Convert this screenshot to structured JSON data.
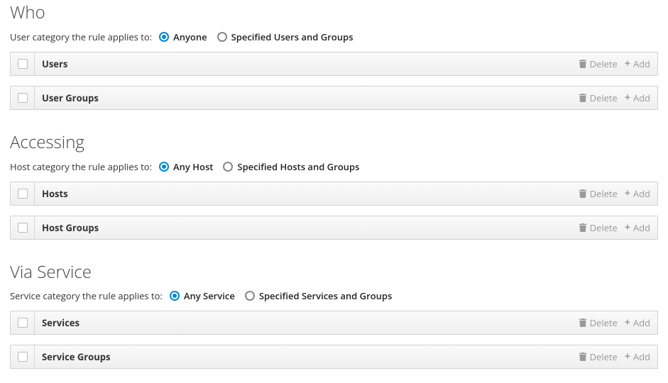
{
  "common": {
    "delete_label": "Delete",
    "add_label": "Add"
  },
  "sections": {
    "who": {
      "heading": "Who",
      "category_label": "User category the rule applies to:",
      "options": [
        {
          "label": "Anyone",
          "selected": true
        },
        {
          "label": "Specified Users and Groups",
          "selected": false
        }
      ],
      "tables": [
        {
          "title": "Users"
        },
        {
          "title": "User Groups"
        }
      ]
    },
    "accessing": {
      "heading": "Accessing",
      "category_label": "Host category the rule applies to:",
      "options": [
        {
          "label": "Any Host",
          "selected": true
        },
        {
          "label": "Specified Hosts and Groups",
          "selected": false
        }
      ],
      "tables": [
        {
          "title": "Hosts"
        },
        {
          "title": "Host Groups"
        }
      ]
    },
    "via_service": {
      "heading": "Via Service",
      "category_label": "Service category the rule applies to:",
      "options": [
        {
          "label": "Any Service",
          "selected": true
        },
        {
          "label": "Specified Services and Groups",
          "selected": false
        }
      ],
      "tables": [
        {
          "title": "Services"
        },
        {
          "title": "Service Groups"
        }
      ]
    }
  }
}
